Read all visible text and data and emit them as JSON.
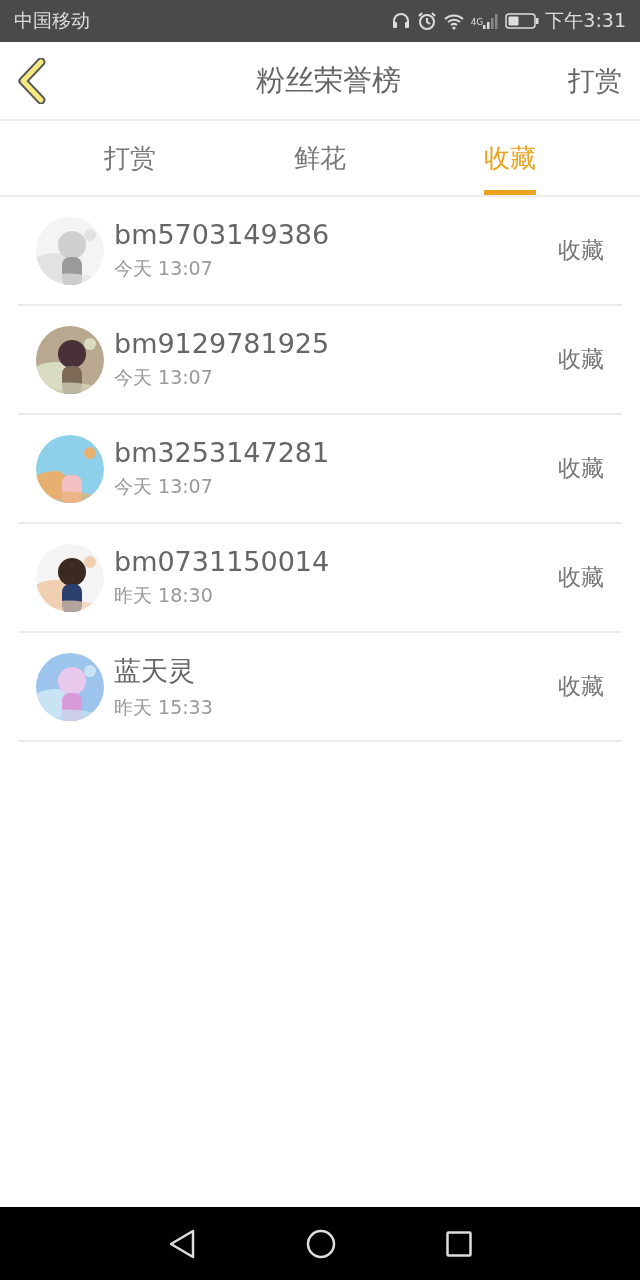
{
  "status_bar": {
    "carrier": "中国移动",
    "network": "4G",
    "time": "下午3:31"
  },
  "header": {
    "title": "粉丝荣誉榜",
    "action": "打赏"
  },
  "tabs": [
    {
      "label": "打赏",
      "selected": false
    },
    {
      "label": "鲜花",
      "selected": false
    },
    {
      "label": "收藏",
      "selected": true
    }
  ],
  "fans": [
    {
      "name": "bm5703149386",
      "time": "今天 13:07",
      "action": "收藏"
    },
    {
      "name": "bm9129781925",
      "time": "今天 13:07",
      "action": "收藏"
    },
    {
      "name": "bm3253147281",
      "time": "今天 13:07",
      "action": "收藏"
    },
    {
      "name": "bm0731150014",
      "time": "昨天 18:30",
      "action": "收藏"
    },
    {
      "name": "蓝天灵",
      "time": "昨天 15:33",
      "action": "收藏"
    }
  ]
}
